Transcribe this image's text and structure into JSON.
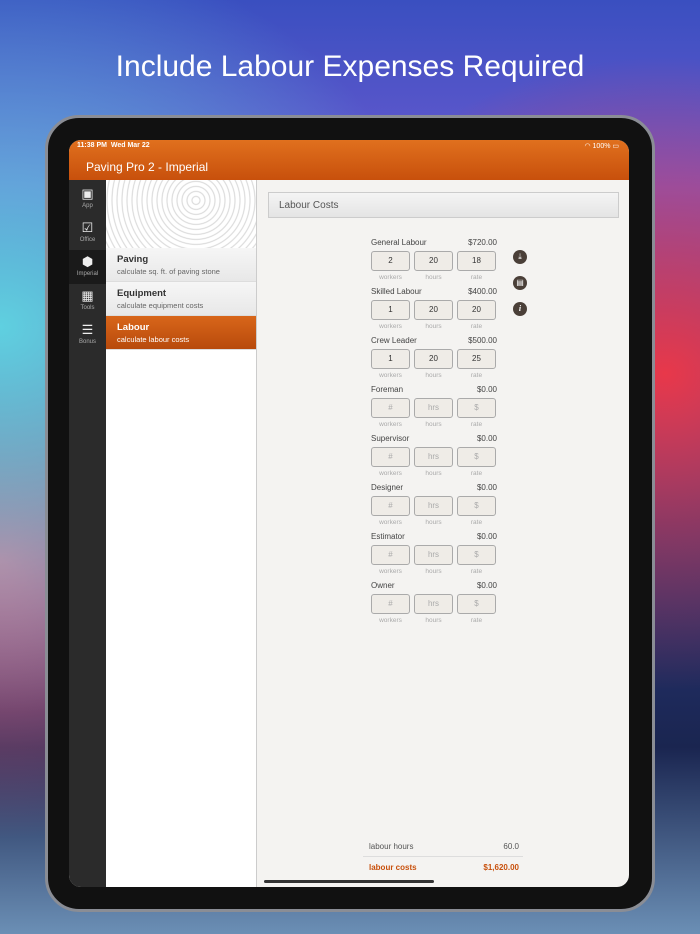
{
  "headline": "Include Labour Expenses Required",
  "status": {
    "time": "11:38 PM",
    "date": "Wed Mar 22",
    "battery": "100%"
  },
  "app_title": "Paving Pro 2 - Imperial",
  "tabs": [
    {
      "label": "App",
      "icon": "chat-icon"
    },
    {
      "label": "Office",
      "icon": "checkbox-icon"
    },
    {
      "label": "Imperial",
      "icon": "cube-icon"
    },
    {
      "label": "Tools",
      "icon": "calendar-icon"
    },
    {
      "label": "Bonus",
      "icon": "list-icon"
    }
  ],
  "menu": [
    {
      "title": "Paving",
      "subtitle": "calculate sq. ft. of paving stone"
    },
    {
      "title": "Equipment",
      "subtitle": "calculate equipment costs"
    },
    {
      "title": "Labour",
      "subtitle": "calculate labour costs"
    }
  ],
  "section_title": "Labour Costs",
  "captions": {
    "workers": "workers",
    "hours": "hours",
    "rate": "rate"
  },
  "rows": [
    {
      "name": "General Labour",
      "amount": "$720.00",
      "workers": "2",
      "hours": "20",
      "rate": "18"
    },
    {
      "name": "Skilled Labour",
      "amount": "$400.00",
      "workers": "1",
      "hours": "20",
      "rate": "20"
    },
    {
      "name": "Crew Leader",
      "amount": "$500.00",
      "workers": "1",
      "hours": "20",
      "rate": "25"
    },
    {
      "name": "Foreman",
      "amount": "$0.00",
      "workers": "",
      "hours": "",
      "rate": ""
    },
    {
      "name": "Supervisor",
      "amount": "$0.00",
      "workers": "",
      "hours": "",
      "rate": ""
    },
    {
      "name": "Designer",
      "amount": "$0.00",
      "workers": "",
      "hours": "",
      "rate": ""
    },
    {
      "name": "Estimator",
      "amount": "$0.00",
      "workers": "",
      "hours": "",
      "rate": ""
    },
    {
      "name": "Owner",
      "amount": "$0.00",
      "workers": "",
      "hours": "",
      "rate": ""
    }
  ],
  "placeholders": {
    "workers": "#",
    "hours": "hrs",
    "rate": "$"
  },
  "totals": {
    "hours_label": "labour hours",
    "hours_value": "60.0",
    "cost_label": "labour costs",
    "cost_value": "$1,620.00"
  },
  "accent": "#c8500c"
}
